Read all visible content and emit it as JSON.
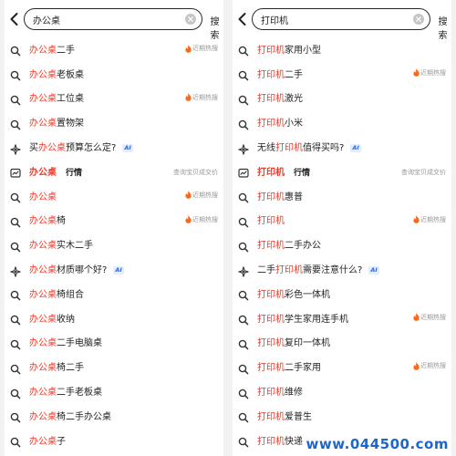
{
  "search_button_label": "搜索",
  "panels": [
    {
      "query": "办公桌",
      "items": [
        {
          "icon": "search",
          "kw": "办公桌",
          "rest": "二手",
          "hot": true
        },
        {
          "icon": "search",
          "kw": "办公桌",
          "rest": "老板桌"
        },
        {
          "icon": "search",
          "kw": "办公桌",
          "rest": "工位桌",
          "hot": true
        },
        {
          "icon": "search",
          "kw": "办公桌",
          "rest": "置物架"
        },
        {
          "icon": "ai",
          "pre": "买",
          "kw": "办公桌",
          "rest": "预算怎么定?",
          "ai": "AI"
        },
        {
          "icon": "chart",
          "kw": "办公桌",
          "tag": "行情",
          "right": "查询宝贝成交价"
        },
        {
          "icon": "search",
          "kw": "办公桌",
          "rest": "",
          "hot": true
        },
        {
          "icon": "search",
          "kw": "办公桌",
          "rest": "椅",
          "hot": true
        },
        {
          "icon": "search",
          "kw": "办公桌",
          "rest": "实木二手"
        },
        {
          "icon": "ai",
          "kw": "办公桌",
          "rest": "材质哪个好?",
          "ai": "AI"
        },
        {
          "icon": "search",
          "kw": "办公桌",
          "rest": "椅组合"
        },
        {
          "icon": "search",
          "kw": "办公桌",
          "rest": "收纳"
        },
        {
          "icon": "search",
          "kw": "办公桌",
          "rest": "二手电脑桌"
        },
        {
          "icon": "search",
          "kw": "办公桌",
          "rest": "椅二手"
        },
        {
          "icon": "search",
          "kw": "办公桌",
          "rest": "二手老板桌"
        },
        {
          "icon": "search",
          "kw": "办公桌",
          "rest": "椅二手办公桌"
        },
        {
          "icon": "search",
          "kw": "办公桌",
          "rest": "子"
        }
      ]
    },
    {
      "query": "打印机",
      "items": [
        {
          "icon": "search",
          "kw": "打印机",
          "rest": "家用小型"
        },
        {
          "icon": "search",
          "kw": "打印机",
          "rest": "二手",
          "hot": true
        },
        {
          "icon": "search",
          "kw": "打印机",
          "rest": "激光"
        },
        {
          "icon": "search",
          "kw": "打印机",
          "rest": "小米"
        },
        {
          "icon": "ai",
          "pre": "无线",
          "kw": "打印机",
          "rest": "值得买吗?",
          "ai": "AI"
        },
        {
          "icon": "chart",
          "kw": "打印机",
          "tag": "行情",
          "right": "查询宝贝成交价"
        },
        {
          "icon": "search",
          "kw": "打印机",
          "rest": "惠普"
        },
        {
          "icon": "search",
          "kw": "打印机",
          "rest": "",
          "hot": true
        },
        {
          "icon": "search",
          "kw": "打印机",
          "rest": "二手办公"
        },
        {
          "icon": "ai",
          "pre": "二手",
          "kw": "打印机",
          "rest": "需要注意什么?",
          "ai": "AI"
        },
        {
          "icon": "search",
          "kw": "打印机",
          "rest": "彩色一体机"
        },
        {
          "icon": "search",
          "kw": "打印机",
          "rest": "学生家用连手机",
          "hot": true
        },
        {
          "icon": "search",
          "kw": "打印机",
          "rest": "复印一体机"
        },
        {
          "icon": "search",
          "kw": "打印机",
          "rest": "二手家用",
          "hot": true
        },
        {
          "icon": "search",
          "kw": "打印机",
          "rest": "维修"
        },
        {
          "icon": "search",
          "kw": "打印机",
          "rest": "爱普生"
        },
        {
          "icon": "search",
          "kw": "打印机",
          "rest": "快递"
        }
      ]
    }
  ],
  "hot_label": "近期热搜",
  "watermark": "www.044500.com",
  "colors": {
    "keyword": "#ee3a2a",
    "ai_badge": "#2b6de8",
    "hot_icon": "#f56a1e",
    "watermark": "#1e66c7"
  }
}
